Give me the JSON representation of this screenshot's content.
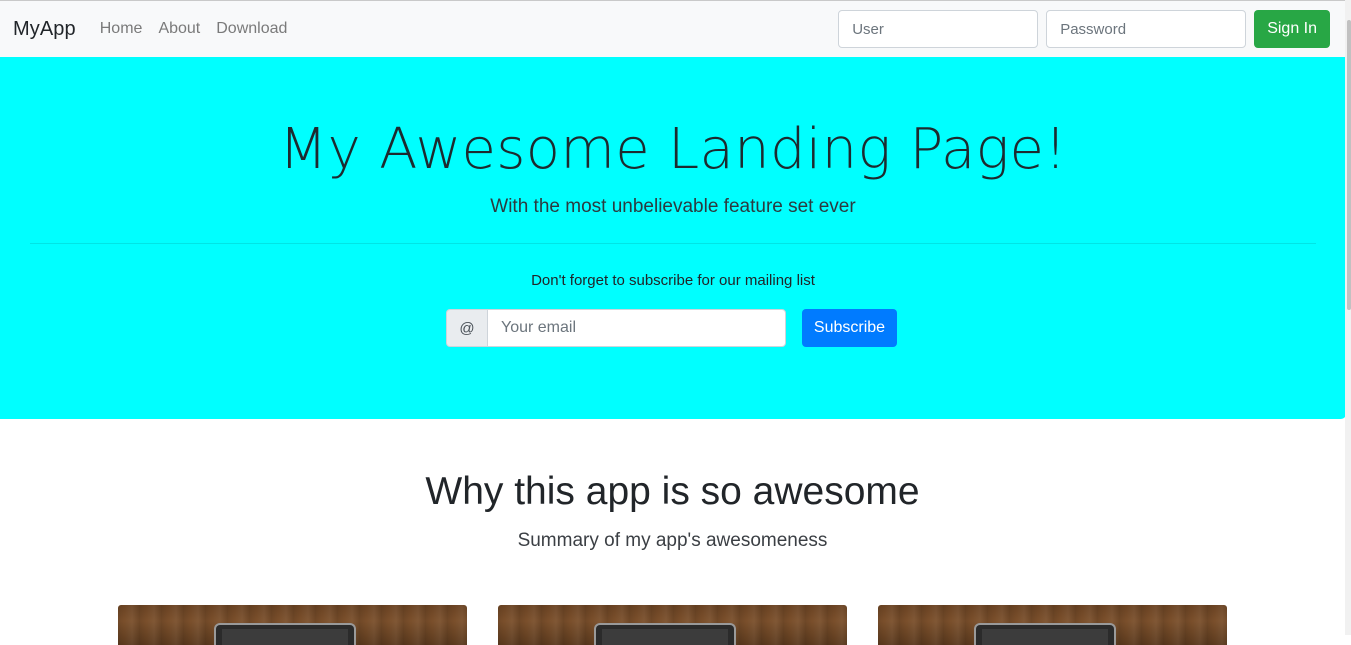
{
  "navbar": {
    "brand": "MyApp",
    "links": [
      "Home",
      "About",
      "Download"
    ],
    "user_placeholder": "User",
    "password_placeholder": "Password",
    "signin_label": "Sign In"
  },
  "hero": {
    "title": "My Awesome Landing Page!",
    "subtitle": "With the most unbelievable feature set ever",
    "note": "Don't forget to subscribe for our mailing list",
    "at_symbol": "@",
    "email_placeholder": "Your email",
    "subscribe_label": "Subscribe",
    "background_color": "#00ffff"
  },
  "features": {
    "title": "Why this app is so awesome",
    "subtitle": "Summary of my app's awesomeness"
  },
  "colors": {
    "signin_button": "#28a745",
    "subscribe_button": "#007bff",
    "navbar_bg": "#f8f9fa"
  }
}
